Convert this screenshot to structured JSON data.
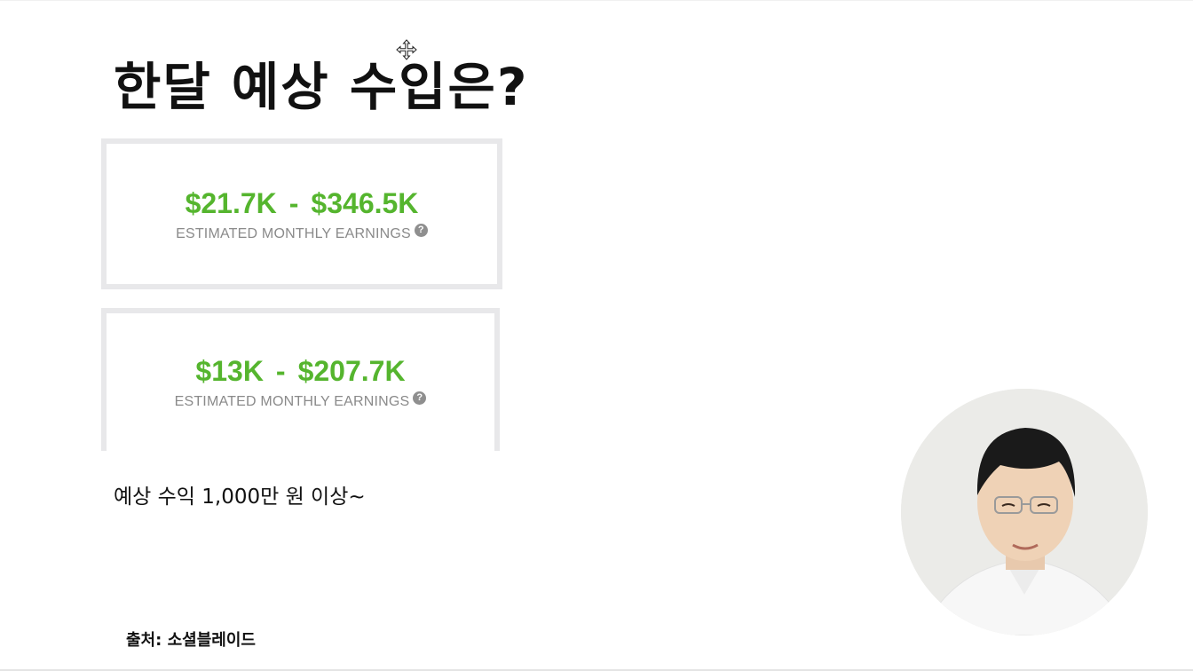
{
  "slide": {
    "title": "한달 예상 수입은?",
    "cards": [
      {
        "min": "$21.7K",
        "separator": "-",
        "max": "$346.5K",
        "label": "ESTIMATED MONTHLY EARNINGS",
        "help_icon": "?"
      },
      {
        "min": "$13K",
        "separator": "-",
        "max": "$207.7K",
        "label": "ESTIMATED MONTHLY EARNINGS",
        "help_icon": "?"
      }
    ],
    "caption": "예상 수익 1,000만 원 이상~",
    "source": "출처: 소셜블레이드"
  },
  "icons": {
    "cursor": "move-cursor-icon",
    "help": "question-circle-icon",
    "presenter": "presenter-video-circle"
  },
  "colors": {
    "earnings_green": "#55b52e",
    "label_gray": "#8a8a8a",
    "card_border": "#e8e8ea",
    "title_text": "#111111"
  }
}
